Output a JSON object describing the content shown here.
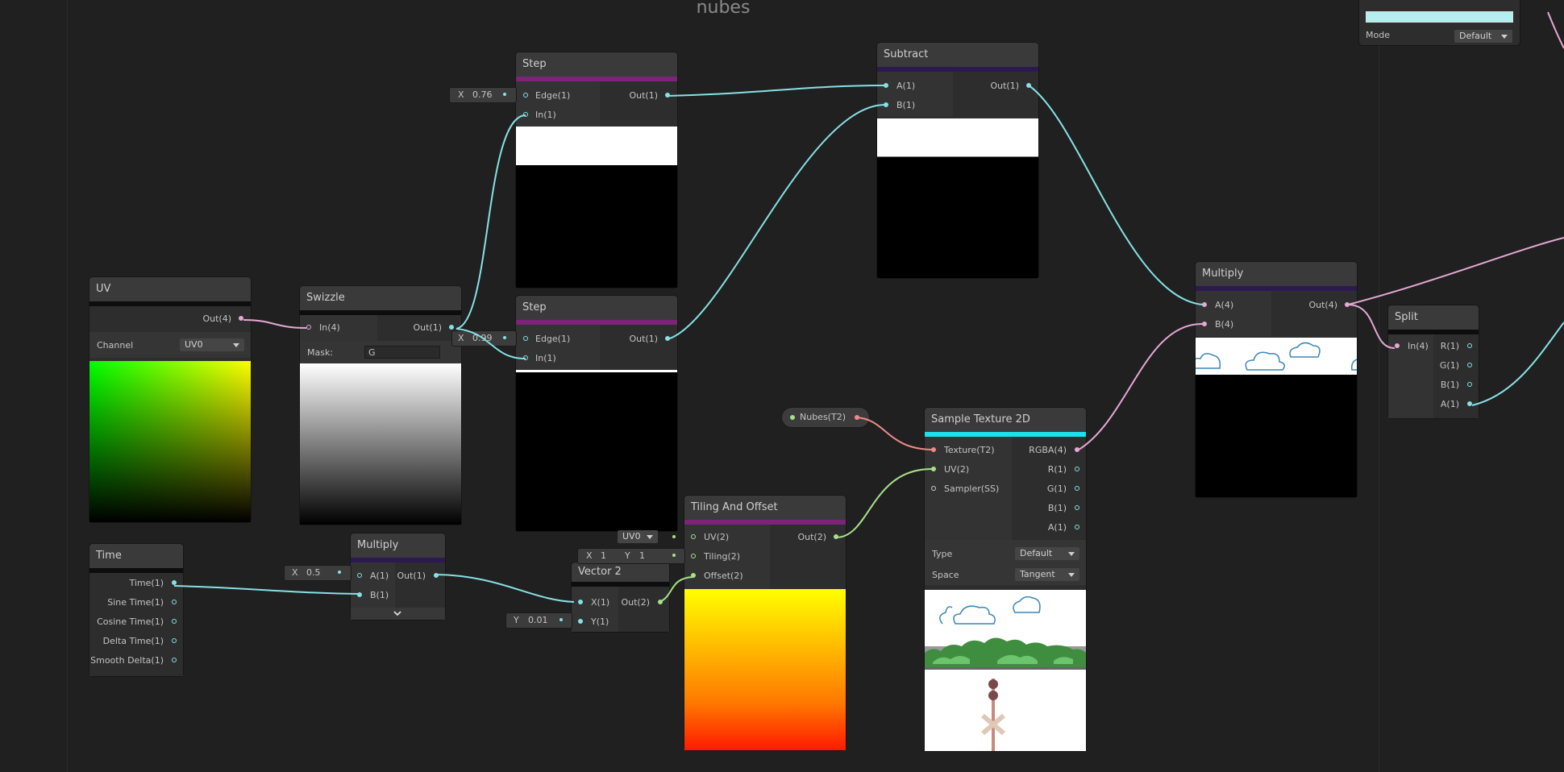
{
  "graph": {
    "title": "nubes"
  },
  "colors": {
    "background": "#202020",
    "node": "#2d2d2d",
    "wire_float": "#86e1e6",
    "wire_vector4": "#e6a8d6",
    "wire_vector2": "#a8e08a",
    "wire_texture": "#f08a8a",
    "bar_math": "#7b2478",
    "bar_input": "#2b1a52",
    "bar_texture": "#1de0ec"
  },
  "top_right": {
    "mode_label": "Mode",
    "mode_value": "Default"
  },
  "uv": {
    "title": "UV",
    "out": "Out(4)",
    "channel_label": "Channel",
    "channel_value": "UV0"
  },
  "swizzle": {
    "title": "Swizzle",
    "in": "In(4)",
    "out": "Out(1)",
    "mask_label": "Mask:",
    "mask_value": "G"
  },
  "step1": {
    "title": "Step",
    "edge": "Edge(1)",
    "in": "In(1)",
    "out": "Out(1)",
    "edge_axis": "X",
    "edge_value": "0.76"
  },
  "step2": {
    "title": "Step",
    "edge": "Edge(1)",
    "in": "In(1)",
    "out": "Out(1)",
    "edge_axis": "X",
    "edge_value": "0.99"
  },
  "subtract": {
    "title": "Subtract",
    "a": "A(1)",
    "b": "B(1)",
    "out": "Out(1)"
  },
  "multiply_main": {
    "title": "Multiply",
    "a": "A(4)",
    "b": "B(4)",
    "out": "Out(4)"
  },
  "split": {
    "title": "Split",
    "in": "In(4)",
    "r": "R(1)",
    "g": "G(1)",
    "b": "B(1)",
    "a": "A(1)"
  },
  "time": {
    "title": "Time",
    "outputs": [
      "Time(1)",
      "Sine Time(1)",
      "Cosine Time(1)",
      "Delta Time(1)",
      "Smooth Delta(1)"
    ]
  },
  "multiply_small": {
    "title": "Multiply",
    "a": "A(1)",
    "b": "B(1)",
    "out": "Out(1)",
    "a_axis": "X",
    "a_value": "0.5",
    "expand_icon": "chevron-down"
  },
  "vector2": {
    "title": "Vector 2",
    "x": "X(1)",
    "y": "Y(1)",
    "out": "Out(2)",
    "y_axis": "Y",
    "y_value": "0.01"
  },
  "tiling": {
    "title": "Tiling And Offset",
    "uv": "UV(2)",
    "tiling": "Tiling(2)",
    "offset": "Offset(2)",
    "out": "Out(2)",
    "uv_value": "UV0",
    "tiling_x_axis": "X",
    "tiling_x": "1",
    "tiling_y_axis": "Y",
    "tiling_y": "1"
  },
  "property": {
    "label": "Nubes(T2)"
  },
  "sample": {
    "title": "Sample Texture 2D",
    "texture": "Texture(T2)",
    "uv": "UV(2)",
    "sampler": "Sampler(SS)",
    "rgba": "RGBA(4)",
    "r": "R(1)",
    "g": "G(1)",
    "b": "B(1)",
    "a": "A(1)",
    "type_label": "Type",
    "type_value": "Default",
    "space_label": "Space",
    "space_value": "Tangent"
  }
}
